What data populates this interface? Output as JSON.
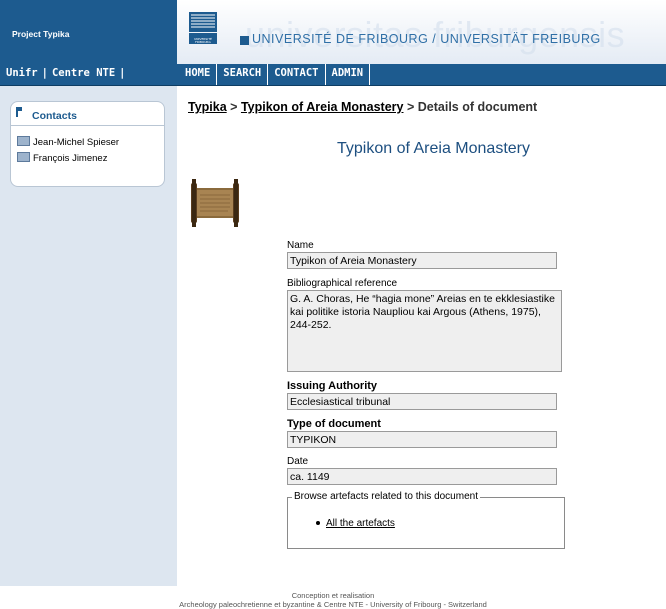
{
  "header": {
    "project_title": "Project Typika",
    "university_name": "UNIVERSITÉ DE FRIBOURG / UNIVERSITÄT FREIBURG",
    "watermark": "universitas friburgensis",
    "logo_caption": "UNIVERSITÉ FRIBOURG"
  },
  "subnav": {
    "items": [
      "Unifr",
      "Centre NTE"
    ]
  },
  "mainnav": {
    "items": [
      "HOME",
      "SEARCH",
      "CONTACT",
      "ADMIN"
    ]
  },
  "sidebar": {
    "contacts_title": "Contacts",
    "contacts": [
      "Jean-Michel Spieser",
      "François Jimenez"
    ]
  },
  "breadcrumb": {
    "items": [
      "Typika",
      "Typikon of Areia Monastery",
      "Details of document"
    ],
    "separator": ">"
  },
  "document": {
    "title": "Typikon of Areia Monastery",
    "name_label": "Name",
    "name_value": "Typikon of Areia Monastery",
    "biblio_label": "Bibliographical reference",
    "biblio_value": "G. A. Choras, He “hagia mone” Areias en te ekklesiastike kai politike istoria Naupliou kai Argous (Athens, 1975), 244-252.",
    "authority_label": "Issuing Authority",
    "authority_value": "Ecclesiastical tribunal",
    "type_label": "Type of document",
    "type_value": "TYPIKON",
    "date_label": "Date",
    "date_value": "ca. 1149"
  },
  "artefacts": {
    "legend": "Browse artefacts related to this document",
    "link": "All the artefacts"
  },
  "footer": {
    "line1": "Conception et realisation",
    "line2": "Archeology paleochretienne et byzantine  &  Centre NTE  -  University of Fribourg  -  Switzerland"
  },
  "colors": {
    "brand_blue": "#1d5b8f",
    "sidebar_bg": "#dde6f0",
    "title_blue": "#1d4f80"
  }
}
